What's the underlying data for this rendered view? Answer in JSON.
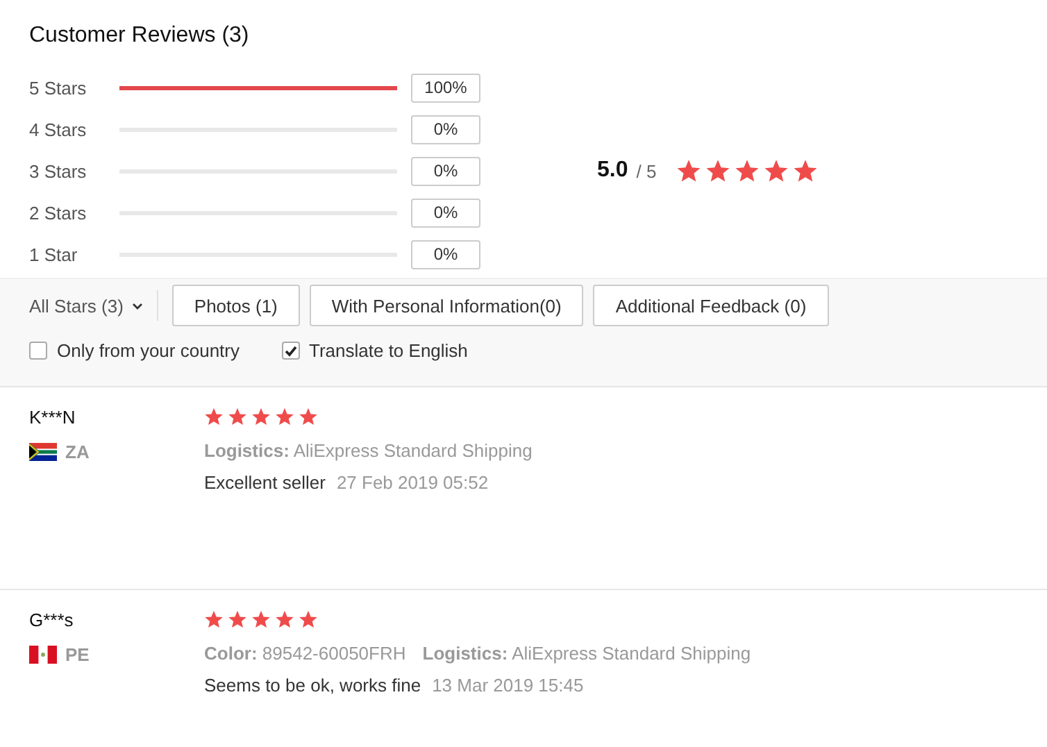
{
  "title": "Customer Reviews (3)",
  "histogram": [
    {
      "label": "5 Stars",
      "level": 1,
      "percent": "100%"
    },
    {
      "label": "4 Stars",
      "level": 0,
      "percent": "0%"
    },
    {
      "label": "3 Stars",
      "level": 0,
      "percent": "0%"
    },
    {
      "label": "2 Stars",
      "level": 0,
      "percent": "0%"
    },
    {
      "label": "1 Star",
      "level": 0,
      "percent": "0%"
    }
  ],
  "summary": {
    "score": "5.0",
    "out_of": "/ 5",
    "stars": 5
  },
  "filters": {
    "dropdown": "All Stars (3)",
    "buttons": [
      "Photos (1)",
      "With Personal Information(0)",
      "Additional Feedback (0)"
    ],
    "checkboxes": [
      {
        "label": "Only from your country",
        "checked": false
      },
      {
        "label": "Translate to English",
        "checked": true
      }
    ]
  },
  "reviews": [
    {
      "name": "K***N",
      "kind": "south-africa",
      "country": "ZA",
      "stars": 5,
      "details": [
        {
          "label": "Logistics:",
          "value": "AliExpress Standard Shipping"
        }
      ],
      "text": "Excellent seller",
      "date": "27 Feb 2019 05:52"
    },
    {
      "name": "G***s",
      "kind": "peru",
      "country": "PE",
      "stars": 5,
      "details": [
        {
          "label": "Color:",
          "value": "89542-60050FRH"
        },
        {
          "label": "Logistics:",
          "value": "AliExpress Standard Shipping"
        }
      ],
      "text": "Seems to be ok, works fine",
      "date": "13 Mar 2019 15:45"
    }
  ]
}
